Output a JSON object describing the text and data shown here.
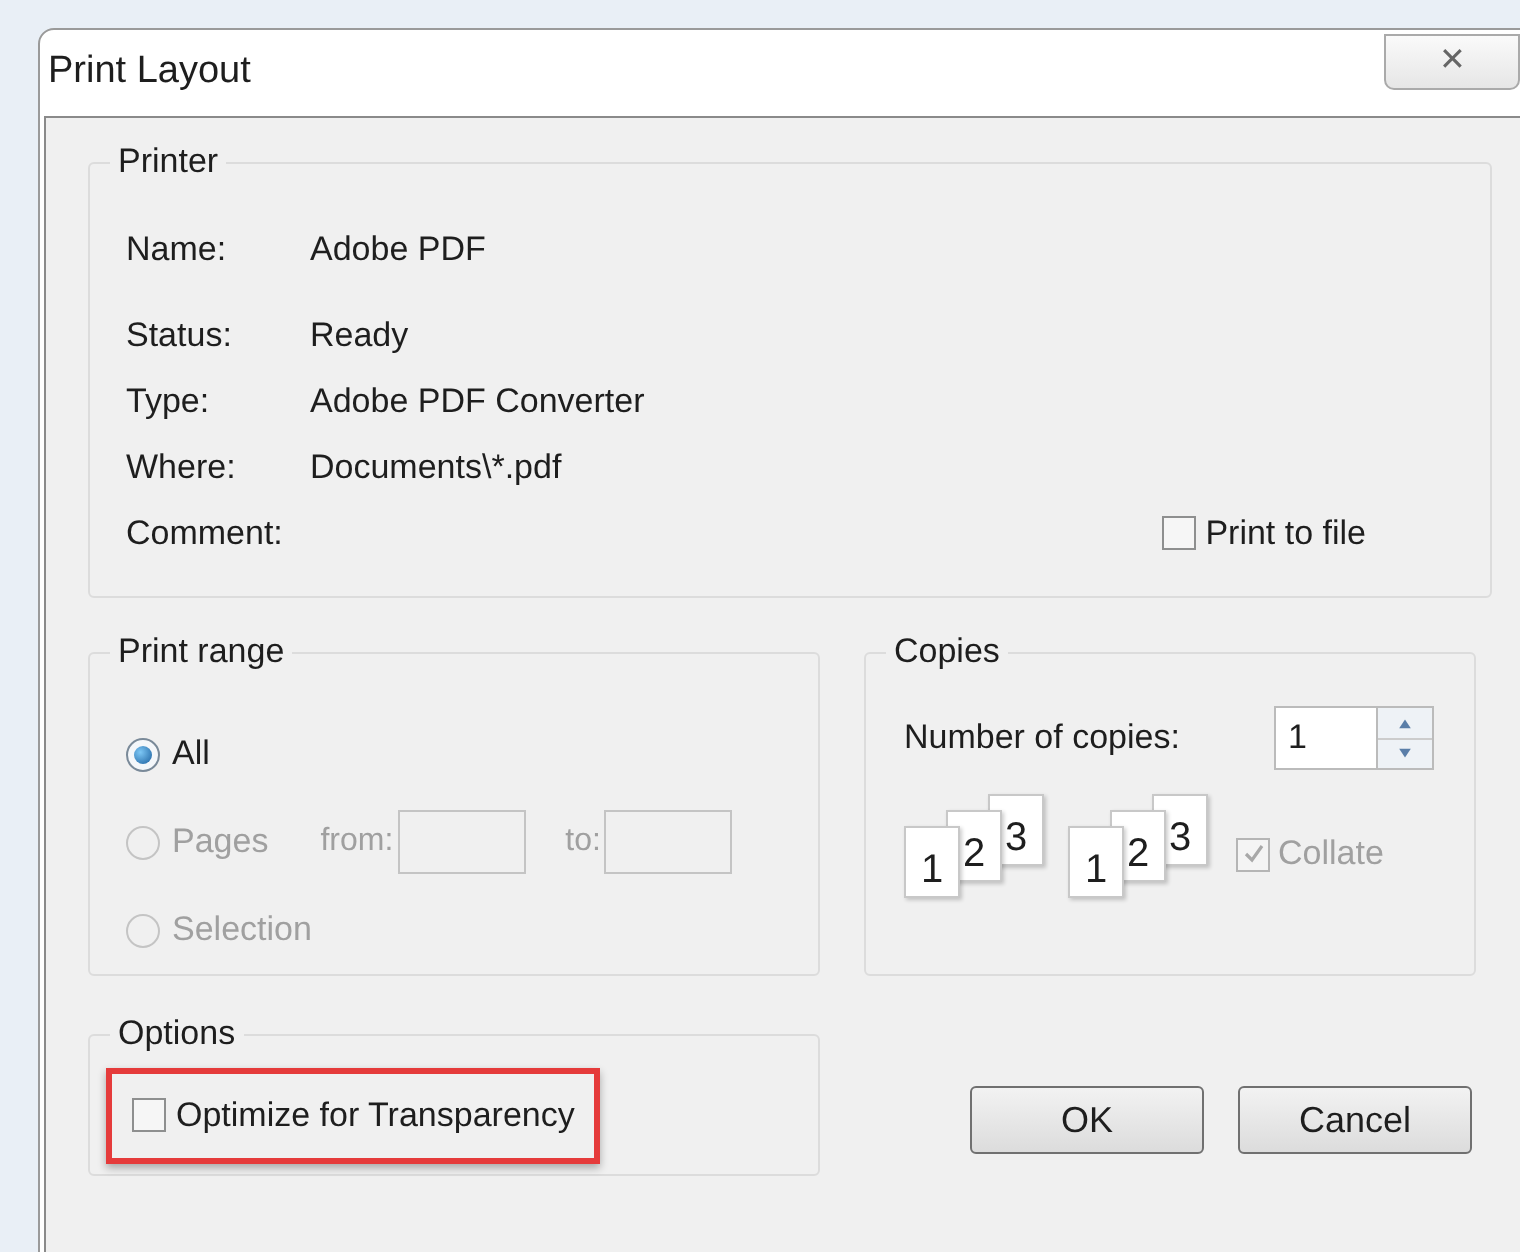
{
  "window": {
    "title": "Print Layout",
    "close": "✕"
  },
  "printer": {
    "title": "Printer",
    "fields": [
      {
        "label": "Name:",
        "value": "Adobe PDF"
      },
      {
        "label": "Status:",
        "value": "Ready"
      },
      {
        "label": "Type:",
        "value": "Adobe PDF Converter"
      },
      {
        "label": "Where:",
        "value": "Documents\\*.pdf"
      },
      {
        "label": "Comment:"
      }
    ],
    "print_to_file": {
      "label": "Print to file",
      "checked": false
    }
  },
  "print_range": {
    "title": "Print range",
    "options": [
      {
        "label": "All",
        "selected": true,
        "disabled": false
      },
      {
        "label": "Pages",
        "selected": false,
        "disabled": true
      },
      {
        "label": "Selection",
        "selected": false,
        "disabled": true
      }
    ],
    "from": {
      "label": "from:",
      "disabled": true
    },
    "to": {
      "label": "to:",
      "disabled": true
    }
  },
  "copies": {
    "title": "Copies",
    "label": "Number of copies:",
    "value": "1",
    "stacks": [
      [
        "1",
        "2",
        "3"
      ],
      [
        "1",
        "2",
        "3"
      ]
    ],
    "collate": {
      "label": "Collate",
      "checked": true,
      "disabled": true
    }
  },
  "options": {
    "title": "Options",
    "items": [
      {
        "label": "Optimize for Transparency",
        "checked": false,
        "highlighted": true
      }
    ]
  },
  "buttons": [
    "OK",
    "Cancel"
  ]
}
